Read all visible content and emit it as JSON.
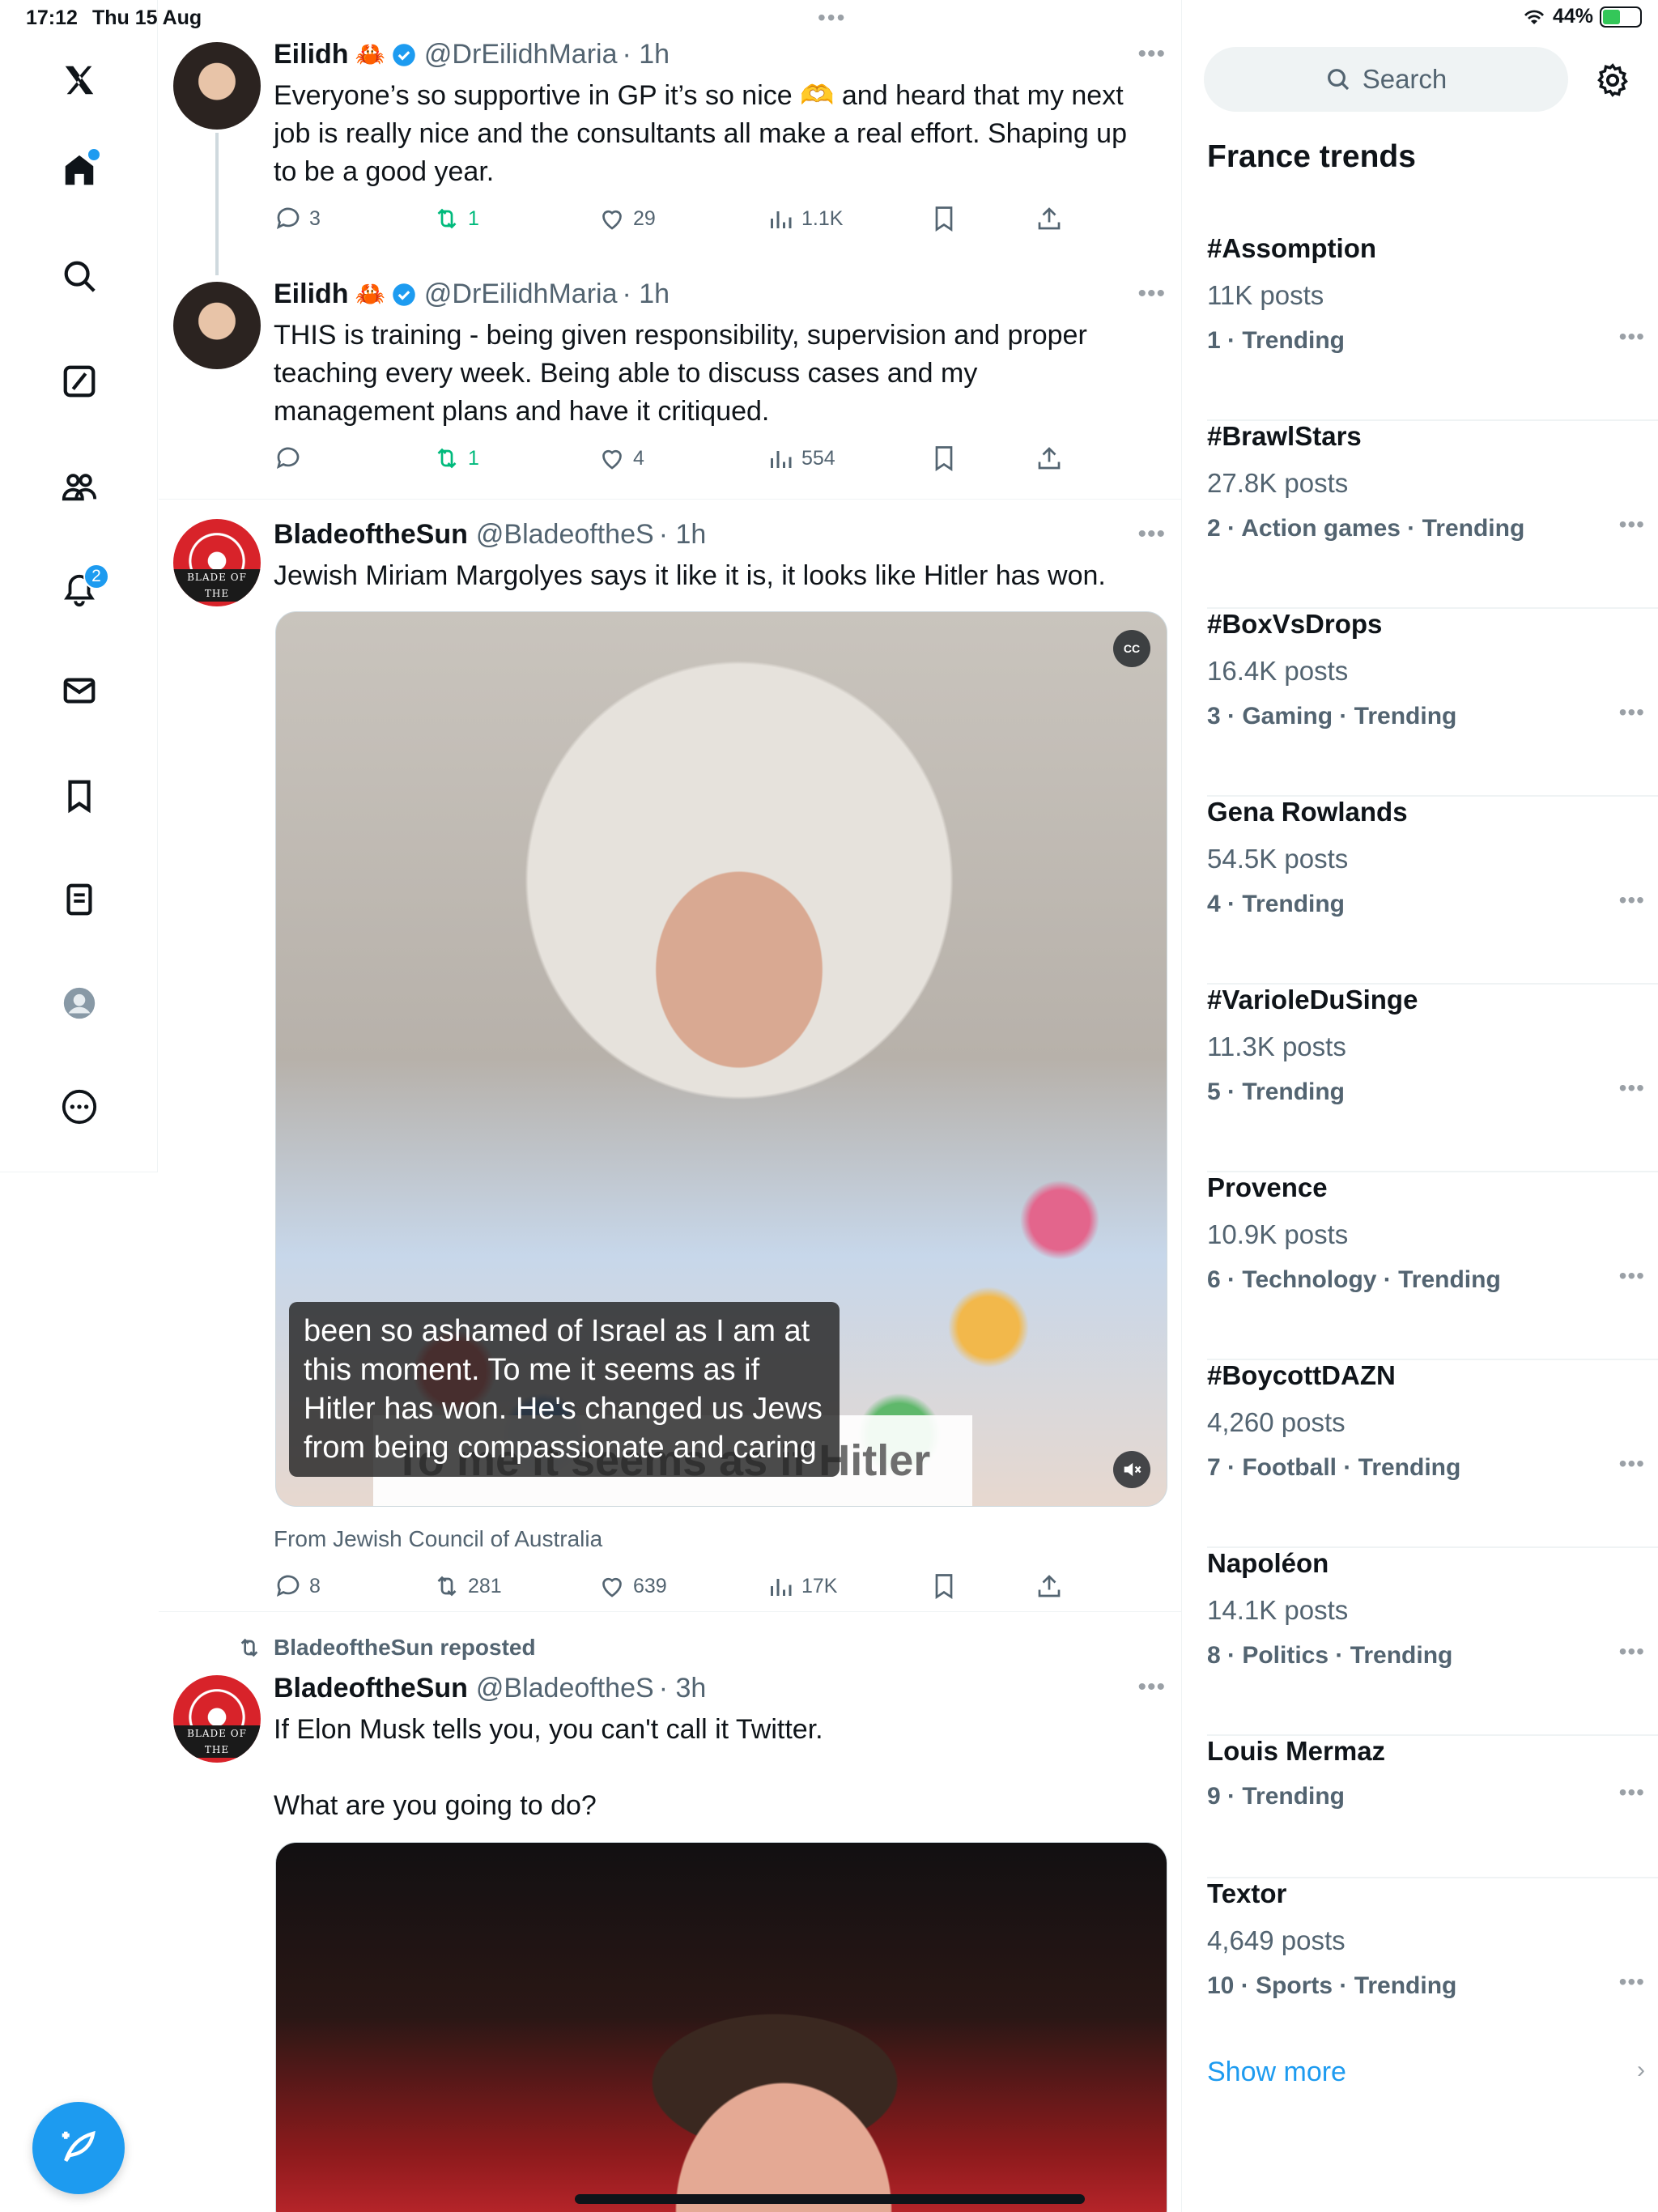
{
  "status_bar": {
    "time": "17:12",
    "date": "Thu 15 Aug",
    "battery": "44%",
    "battery_level": 0.44
  },
  "nav": {
    "items": [
      "x-logo",
      "home",
      "explore",
      "grok",
      "communities",
      "notifications",
      "messages",
      "bookmarks",
      "lists",
      "profile",
      "more"
    ],
    "notifications_count": "2"
  },
  "tweets": [
    {
      "name": "Eilidh",
      "emoji": "🦀",
      "verified": true,
      "handle": "@DrEilidhMaria",
      "time": "· 1h",
      "text": "Everyone’s so supportive in GP it’s so nice 🫶 and heard that my next job is really nice and the consultants all make a real effort. Shaping up to be a good year.",
      "replies": "3",
      "reposts": "1",
      "likes": "29",
      "views": "1.1K"
    },
    {
      "name": "Eilidh",
      "emoji": "🦀",
      "verified": true,
      "handle": "@DrEilidhMaria",
      "time": "· 1h",
      "text": "THIS is training - being given responsibility, supervision and proper teaching every week. Being able to discuss cases and my management plans and have it critiqued.",
      "replies": "",
      "reposts": "1",
      "likes": "4",
      "views": "554"
    },
    {
      "name": "BladeoftheSun",
      "handle": "@BladeoftheS",
      "time": "· 1h",
      "avatar_text": "BLADE OF THE",
      "text": "Jewish Miriam Margolyes says it like it is, it looks like Hitler has won.",
      "media_subtitle": "been so ashamed of Israel as I am at this moment. To me it seems as if Hitler has won. He's changed us Jews from being compassionate and caring",
      "media_caption": "To me it seems as if Hitler",
      "cc_label": "CC",
      "source": "From Jewish Council of Australia",
      "replies": "8",
      "reposts": "281",
      "likes": "639",
      "views": "17K"
    },
    {
      "repost_label": "BladeoftheSun reposted",
      "name": "BladeoftheSun",
      "handle": "@BladeoftheS",
      "time": "· 3h",
      "avatar_text": "BLADE OF THE",
      "text": "If Elon Musk tells you, you can't call it Twitter.\n\nWhat are you going to do?"
    }
  ],
  "sidebar": {
    "search_placeholder": "Search",
    "trends_title": "France trends",
    "trends": [
      {
        "name": "#Assomption",
        "posts": "11K posts",
        "meta": "1 · Trending"
      },
      {
        "name": "#BrawlStars",
        "posts": "27.8K posts",
        "meta": "2 · Action games · Trending"
      },
      {
        "name": "#BoxVsDrops",
        "posts": "16.4K posts",
        "meta": "3 · Gaming · Trending"
      },
      {
        "name": "Gena Rowlands",
        "posts": "54.5K posts",
        "meta": "4 · Trending"
      },
      {
        "name": "#VarioleDuSinge",
        "posts": "11.3K posts",
        "meta": "5 · Trending"
      },
      {
        "name": "Provence",
        "posts": "10.9K posts",
        "meta": "6 · Technology · Trending"
      },
      {
        "name": "#BoycottDAZN",
        "posts": "4,260 posts",
        "meta": "7 · Football · Trending"
      },
      {
        "name": "Napoléon",
        "posts": "14.1K posts",
        "meta": "8 · Politics · Trending"
      },
      {
        "name": "Louis Mermaz",
        "posts": "",
        "meta": "9 · Trending"
      },
      {
        "name": "Textor",
        "posts": "4,649 posts",
        "meta": "10 · Sports · Trending"
      }
    ],
    "show_more": "Show more"
  },
  "colors": {
    "accent": "#1d9bf0",
    "repost_green": "#00ba7c",
    "secondary_text": "#536471"
  }
}
